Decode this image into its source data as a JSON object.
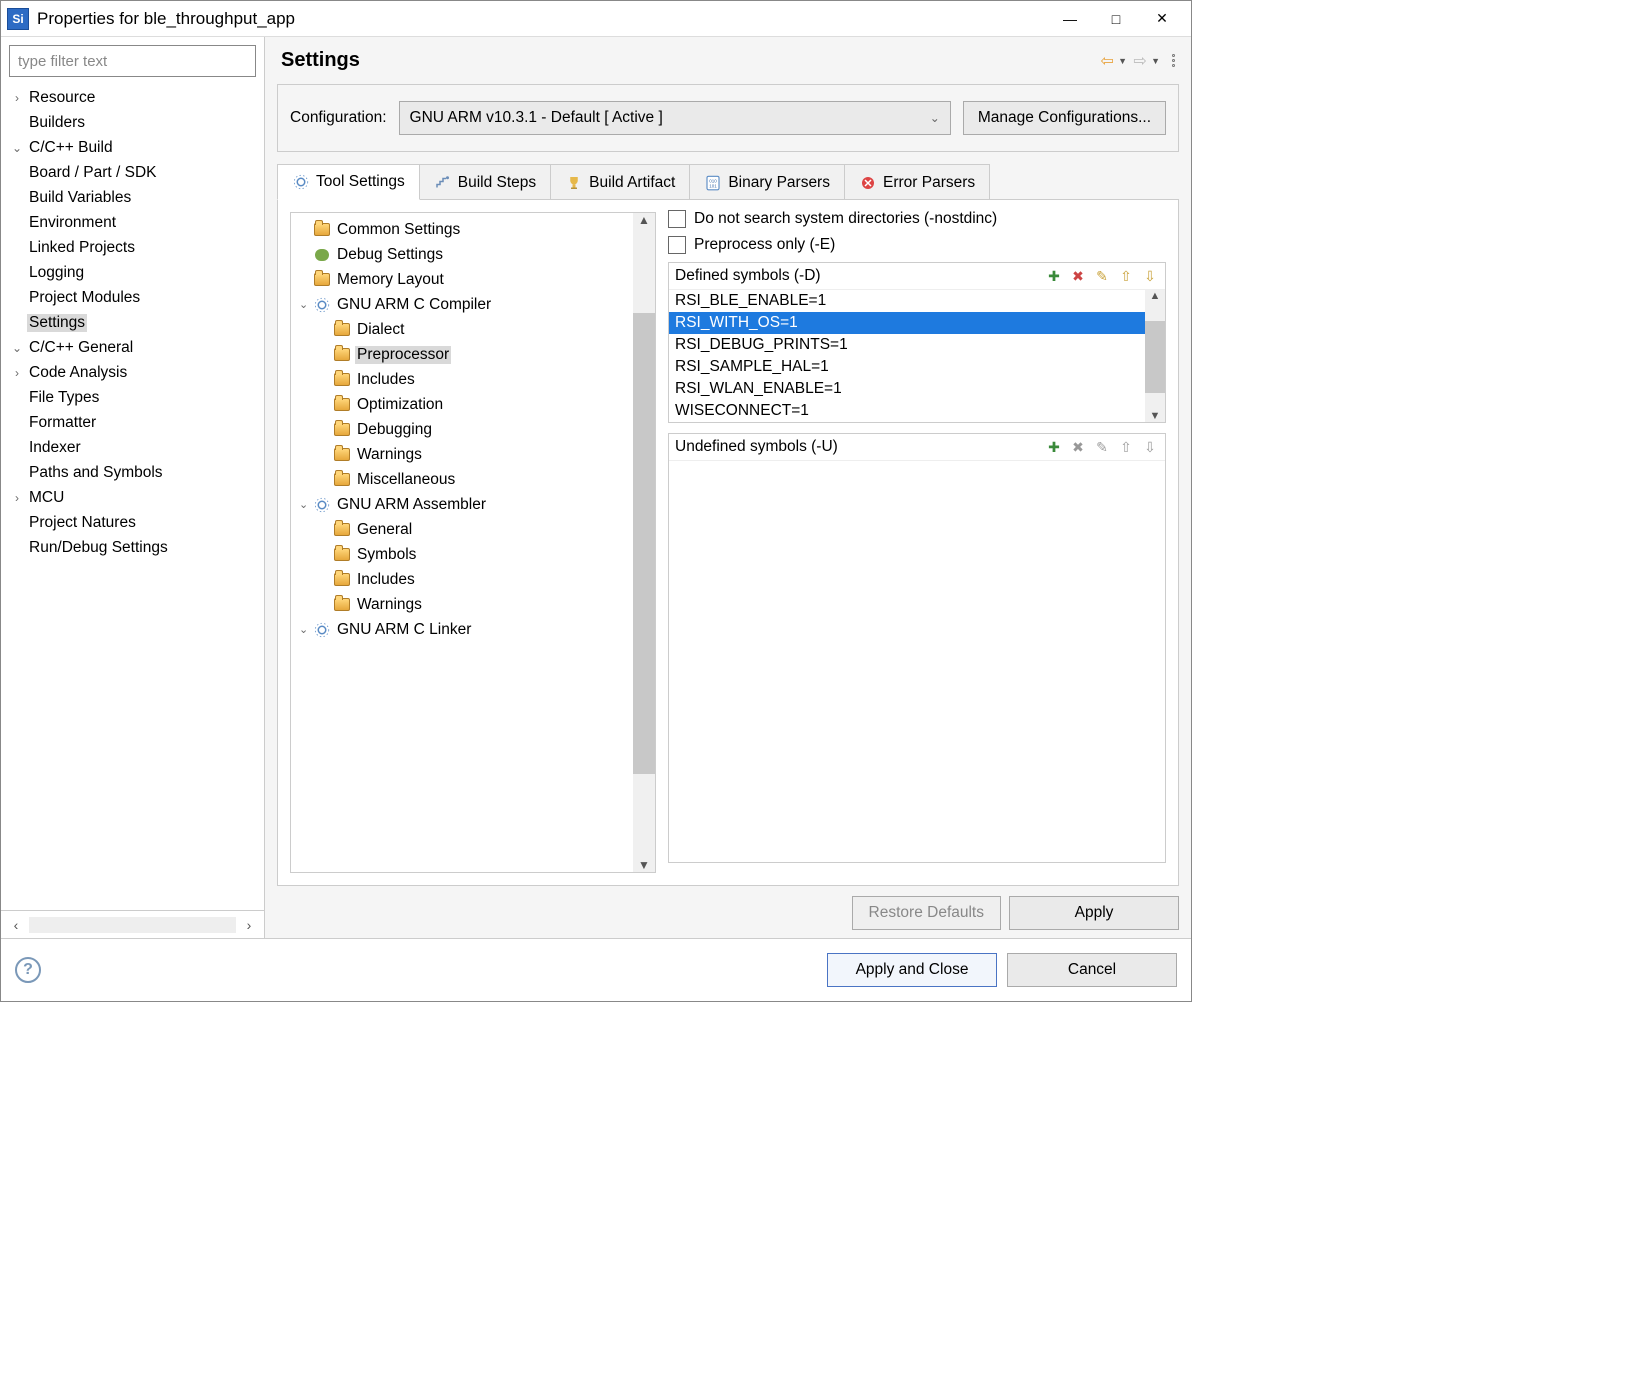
{
  "window": {
    "title": "Properties for ble_throughput_app",
    "minimize": "—",
    "maximize": "□",
    "close": "✕",
    "app_icon_text": "Si"
  },
  "filter_placeholder": "type filter text",
  "nav": [
    {
      "label": "Resource",
      "twisty": "›",
      "depth": 0
    },
    {
      "label": "Builders",
      "twisty": "",
      "depth": 0
    },
    {
      "label": "C/C++ Build",
      "twisty": "⌄",
      "depth": 0
    },
    {
      "label": "Board / Part / SDK",
      "twisty": "",
      "depth": 1
    },
    {
      "label": "Build Variables",
      "twisty": "",
      "depth": 1
    },
    {
      "label": "Environment",
      "twisty": "",
      "depth": 1
    },
    {
      "label": "Linked Projects",
      "twisty": "",
      "depth": 1
    },
    {
      "label": "Logging",
      "twisty": "",
      "depth": 1
    },
    {
      "label": "Project Modules",
      "twisty": "",
      "depth": 1
    },
    {
      "label": "Settings",
      "twisty": "",
      "depth": 1,
      "selected": true
    },
    {
      "label": "C/C++ General",
      "twisty": "⌄",
      "depth": 0
    },
    {
      "label": "Code Analysis",
      "twisty": "›",
      "depth": 1
    },
    {
      "label": "File Types",
      "twisty": "",
      "depth": 1
    },
    {
      "label": "Formatter",
      "twisty": "",
      "depth": 1
    },
    {
      "label": "Indexer",
      "twisty": "",
      "depth": 1
    },
    {
      "label": "Paths and Symbols",
      "twisty": "",
      "depth": 1
    },
    {
      "label": "MCU",
      "twisty": "›",
      "depth": 0
    },
    {
      "label": "Project Natures",
      "twisty": "",
      "depth": 0
    },
    {
      "label": "Run/Debug Settings",
      "twisty": "",
      "depth": 0
    }
  ],
  "page_title": "Settings",
  "config": {
    "label": "Configuration:",
    "value": "GNU ARM v10.3.1 - Default  [ Active ]",
    "manage": "Manage Configurations..."
  },
  "tabs": [
    {
      "label": "Tool Settings",
      "active": true,
      "icon": "cog"
    },
    {
      "label": "Build Steps",
      "active": false,
      "icon": "steps"
    },
    {
      "label": "Build Artifact",
      "active": false,
      "icon": "trophy"
    },
    {
      "label": "Binary Parsers",
      "active": false,
      "icon": "binary"
    },
    {
      "label": "Error Parsers",
      "active": false,
      "icon": "error"
    }
  ],
  "tool_tree": [
    {
      "label": "Common Settings",
      "depth": 0,
      "icon": "folder",
      "twisty": ""
    },
    {
      "label": "Debug Settings",
      "depth": 0,
      "icon": "bug",
      "twisty": ""
    },
    {
      "label": "Memory Layout",
      "depth": 0,
      "icon": "folder",
      "twisty": ""
    },
    {
      "label": "GNU ARM C Compiler",
      "depth": 0,
      "icon": "cog",
      "twisty": "⌄"
    },
    {
      "label": "Dialect",
      "depth": 1,
      "icon": "folder",
      "twisty": ""
    },
    {
      "label": "Preprocessor",
      "depth": 1,
      "icon": "folder",
      "twisty": "",
      "selected": true
    },
    {
      "label": "Includes",
      "depth": 1,
      "icon": "folder",
      "twisty": ""
    },
    {
      "label": "Optimization",
      "depth": 1,
      "icon": "folder",
      "twisty": ""
    },
    {
      "label": "Debugging",
      "depth": 1,
      "icon": "folder",
      "twisty": ""
    },
    {
      "label": "Warnings",
      "depth": 1,
      "icon": "folder",
      "twisty": ""
    },
    {
      "label": "Miscellaneous",
      "depth": 1,
      "icon": "folder",
      "twisty": ""
    },
    {
      "label": "GNU ARM Assembler",
      "depth": 0,
      "icon": "cog",
      "twisty": "⌄"
    },
    {
      "label": "General",
      "depth": 1,
      "icon": "folder",
      "twisty": ""
    },
    {
      "label": "Symbols",
      "depth": 1,
      "icon": "folder",
      "twisty": ""
    },
    {
      "label": "Includes",
      "depth": 1,
      "icon": "folder",
      "twisty": ""
    },
    {
      "label": "Warnings",
      "depth": 1,
      "icon": "folder",
      "twisty": ""
    },
    {
      "label": "GNU ARM C Linker",
      "depth": 0,
      "icon": "cog",
      "twisty": "⌄"
    }
  ],
  "checkboxes": {
    "nostdinc": "Do not search system directories (-nostdinc)",
    "preprocess_only": "Preprocess only (-E)"
  },
  "defined": {
    "title": "Defined symbols (-D)",
    "items": [
      "RSI_BLE_ENABLE=1",
      "RSI_WITH_OS=1",
      "RSI_DEBUG_PRINTS=1",
      "RSI_SAMPLE_HAL=1",
      "RSI_WLAN_ENABLE=1",
      "WISECONNECT=1"
    ],
    "selected_index": 1
  },
  "undefined": {
    "title": "Undefined symbols (-U)",
    "items": []
  },
  "buttons": {
    "restore": "Restore Defaults",
    "apply": "Apply",
    "apply_close": "Apply and Close",
    "cancel": "Cancel"
  }
}
